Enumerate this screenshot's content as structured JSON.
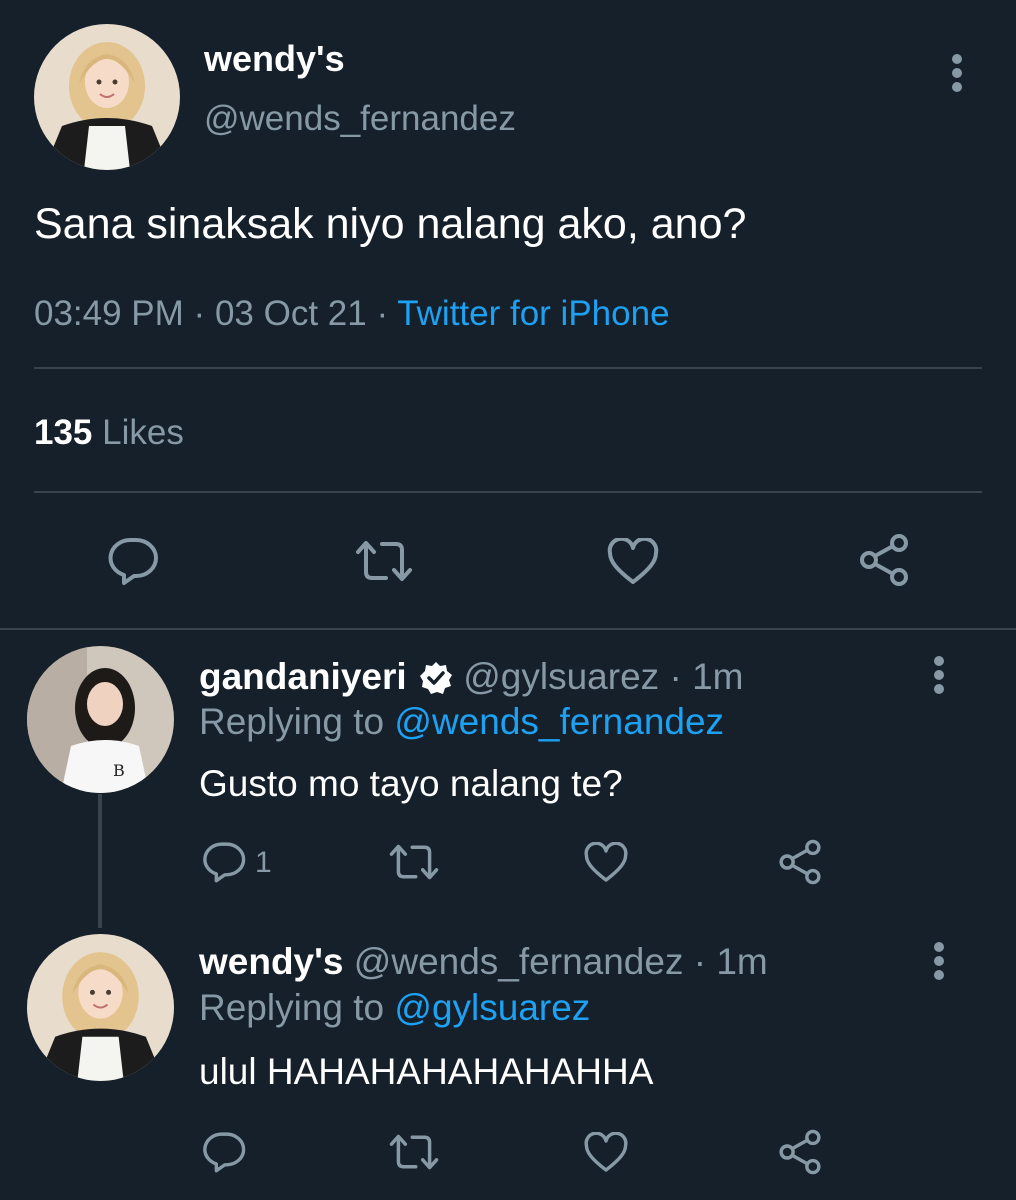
{
  "main_tweet": {
    "display_name": "wendy's",
    "handle": "@wends_fernandez",
    "text": "Sana sinaksak niyo nalang ako, ano?",
    "time": "03:49 PM",
    "separator": "·",
    "date": "03 Oct 21",
    "source": "Twitter for iPhone",
    "likes_count": "135",
    "likes_label": "Likes"
  },
  "replies": [
    {
      "display_name": "gandaniyeri",
      "verified": true,
      "handle": "@gylsuarez",
      "separator": "·",
      "age": "1m",
      "replying_prefix": "Replying to",
      "replying_to": "@wends_fernandez",
      "text": "Gusto mo tayo nalang te?",
      "reply_count": "1"
    },
    {
      "display_name": "wendy's",
      "verified": false,
      "handle": "@wends_fernandez",
      "separator": "·",
      "age": "1m",
      "replying_prefix": "Replying to",
      "replying_to": "@gylsuarez",
      "text": "ulul HAHAHAHAHAHAHHA",
      "reply_count": ""
    }
  ],
  "colors": {
    "background": "#15202b",
    "muted": "#8899a6",
    "accent": "#1da1f2",
    "divider": "#38444d",
    "text": "#ffffff"
  },
  "icons": [
    "more-icon",
    "reply-icon",
    "retweet-icon",
    "like-icon",
    "share-icon",
    "verified-badge-icon"
  ]
}
